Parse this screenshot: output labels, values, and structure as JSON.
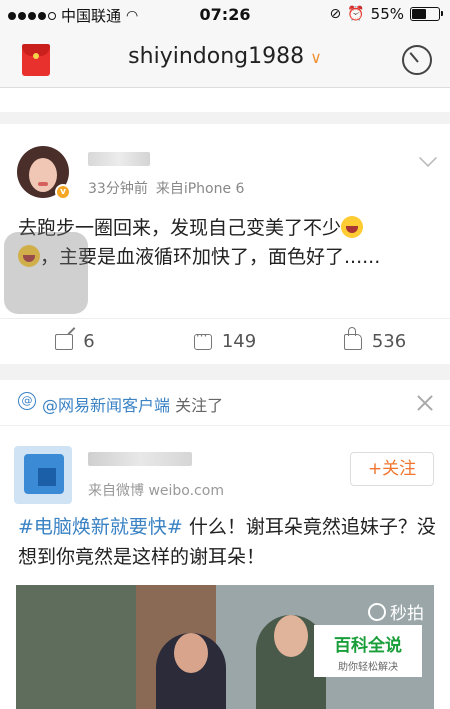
{
  "status_bar": {
    "carrier": "中国联通",
    "time": "07:26",
    "battery": "55%",
    "battery_level": 0.55
  },
  "nav": {
    "title": "shiyindong1988",
    "chevron": "∨"
  },
  "post1": {
    "time": "33分钟前",
    "source": "来自iPhone 6",
    "text_part1": "去跑步一圈回来，发现自己变美了不少",
    "text_part2": "，主要是血液循环加快了，面色好了......",
    "actions": {
      "share_count": "6",
      "comment_count": "149",
      "like_count": "536"
    }
  },
  "post2": {
    "notice_link": "@网易新闻客户端",
    "notice_text": " 关注了",
    "source": "来自微博 weibo.com",
    "follow_label": "+关注",
    "tag": "#电脑焕新就要快#",
    "text": " 什么！谢耳朵竟然追妹子？没想到你竟然是这样的谢耳朵！",
    "video_watermark": "秒拍",
    "baike_title": "百科全说",
    "baike_sub": "助你轻松解决"
  },
  "icons": [
    "wifi-icon",
    "lock-rotation-icon",
    "alarm-icon",
    "battery-icon",
    "red-packet-icon",
    "radar-icon",
    "dropdown-chevron-icon",
    "share-icon",
    "comment-icon",
    "like-icon",
    "at-icon",
    "close-icon",
    "camera-icon"
  ]
}
